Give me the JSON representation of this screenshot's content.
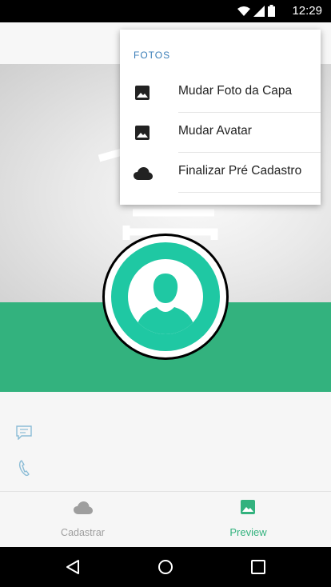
{
  "status_bar": {
    "time": "12:29"
  },
  "menu": {
    "header": "FOTOS",
    "items": [
      {
        "label": "Mudar Foto da Capa",
        "icon": "image-icon"
      },
      {
        "label": "Mudar Avatar",
        "icon": "image-icon"
      },
      {
        "label": "Finalizar Pré Cadastro",
        "icon": "cloud-icon"
      }
    ]
  },
  "bottom_nav": {
    "items": [
      {
        "label": "Cadastrar",
        "icon": "cloud-icon",
        "active": false
      },
      {
        "label": "Preview",
        "icon": "image-icon",
        "active": true
      }
    ]
  },
  "colors": {
    "accent_green": "#33b27e",
    "avatar_teal": "#1fc8a3",
    "menu_header_blue": "#3a7eb8",
    "inactive_gray": "#9e9e9e"
  }
}
